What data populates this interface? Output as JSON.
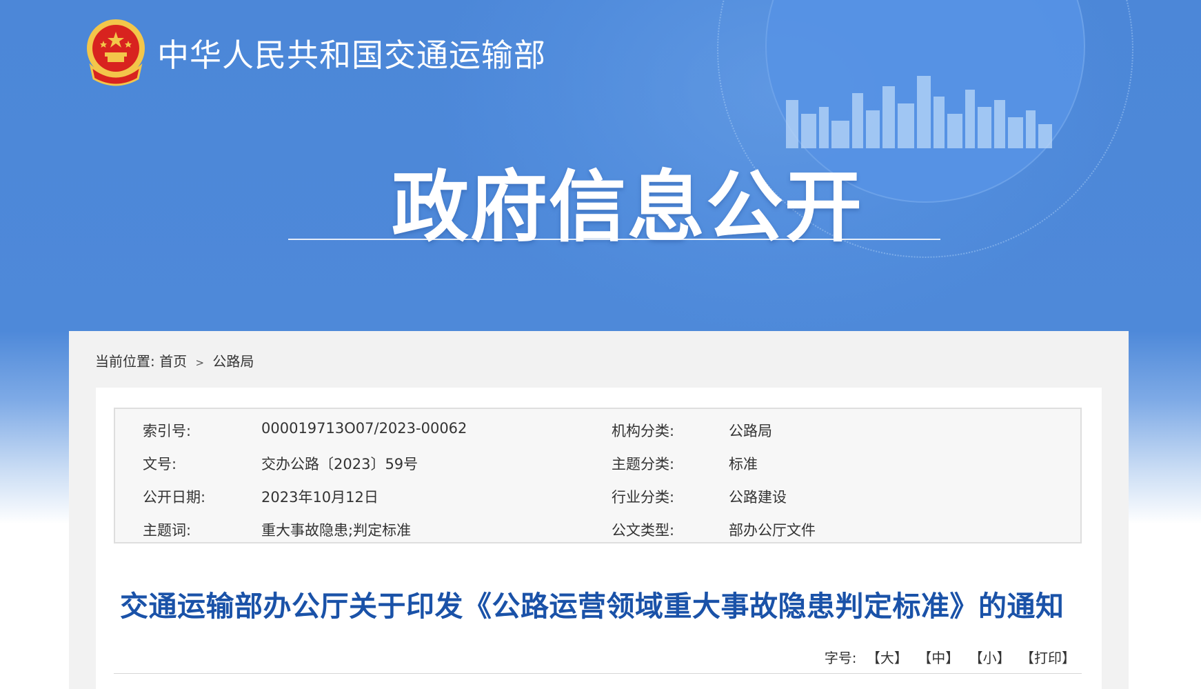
{
  "header": {
    "ministry_name": "中华人民共和国交通运输部",
    "section_title": "政府信息公开"
  },
  "breadcrumb": {
    "label": "当前位置:",
    "items": [
      "首页",
      "公路局"
    ],
    "separator": ">"
  },
  "meta": {
    "rows": [
      {
        "k1": "索引号:",
        "v1": "000019713O07/2023-00062",
        "k2": "机构分类:",
        "v2": "公路局"
      },
      {
        "k1": "文号:",
        "v1": "交办公路〔2023〕59号",
        "k2": "主题分类:",
        "v2": "标准"
      },
      {
        "k1": "公开日期:",
        "v1": "2023年10月12日",
        "k2": "行业分类:",
        "v2": "公路建设"
      },
      {
        "k1": "主题词:",
        "v1": "重大事故隐患;判定标准",
        "k2": "公文类型:",
        "v2": "部办公厅文件"
      }
    ]
  },
  "document": {
    "title": "交通运输部办公厅关于印发《公路运营领域重大事故隐患判定标准》的通知"
  },
  "font_controls": {
    "label": "字号:",
    "large": "【大】",
    "medium": "【中】",
    "small": "【小】",
    "print": "【打印】"
  },
  "colors": {
    "banner_blue": "#4c87d8",
    "title_blue": "#1a52a8",
    "emblem_red": "#d8231f",
    "emblem_gold": "#f3c64a"
  }
}
